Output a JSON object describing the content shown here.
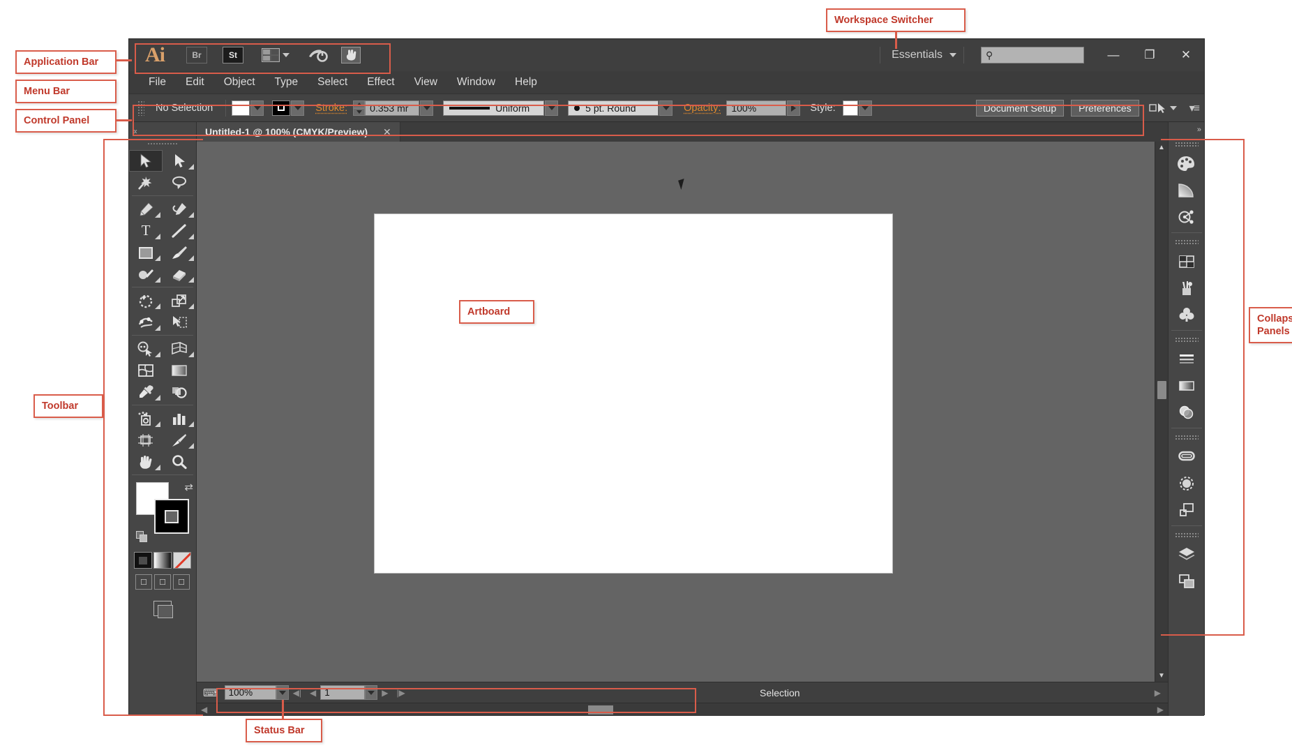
{
  "app": {
    "logo": "Ai",
    "buttons": [
      {
        "name": "bridge-button",
        "label": "Br"
      },
      {
        "name": "stock-button",
        "label": "St"
      }
    ],
    "arrange_documents": "arrange-documents-icon",
    "gear": "gear-icon",
    "hand": "hand-pointer-icon",
    "workspace": "Essentials",
    "search_placeholder": "",
    "search_value": "",
    "window_controls": {
      "minimize": "—",
      "maximize": "❐",
      "close": "✕"
    }
  },
  "menu": {
    "items": [
      "File",
      "Edit",
      "Object",
      "Type",
      "Select",
      "Effect",
      "View",
      "Window",
      "Help"
    ]
  },
  "control_panel": {
    "selection_state": "No Selection",
    "fill_label": "fill-swatch",
    "stroke_label": "stroke-swatch",
    "stroke_text": "Stroke:",
    "stroke_weight": "0.353 mr",
    "stroke_profile": "Uniform",
    "brush_definition": "5 pt. Round",
    "opacity_text": "Opacity:",
    "opacity_value": "100%",
    "style_text": "Style:",
    "document_setup": "Document Setup",
    "preferences": "Preferences"
  },
  "toolbar": {
    "collapse": "«",
    "tools": [
      {
        "name": "selection-tool",
        "glyph": "selection",
        "active": true,
        "corner": false
      },
      {
        "name": "direct-selection-tool",
        "glyph": "direct-selection",
        "active": false,
        "corner": true
      },
      {
        "name": "magic-wand-tool",
        "glyph": "magic-wand",
        "active": false,
        "corner": false
      },
      {
        "name": "lasso-tool",
        "glyph": "lasso",
        "active": false,
        "corner": false
      },
      {
        "name": "pen-tool",
        "glyph": "pen",
        "active": false,
        "corner": true
      },
      {
        "name": "curvature-tool",
        "glyph": "curvature",
        "active": false,
        "corner": true
      },
      {
        "name": "type-tool",
        "glyph": "type",
        "active": false,
        "corner": true
      },
      {
        "name": "line-segment-tool",
        "glyph": "line",
        "active": false,
        "corner": true
      },
      {
        "name": "rectangle-tool",
        "glyph": "rectangle",
        "active": false,
        "corner": true
      },
      {
        "name": "paintbrush-tool",
        "glyph": "paintbrush",
        "active": false,
        "corner": true
      },
      {
        "name": "shaper-tool",
        "glyph": "shaper",
        "active": false,
        "corner": true
      },
      {
        "name": "eraser-tool",
        "glyph": "eraser",
        "active": false,
        "corner": true
      },
      {
        "name": "rotate-tool",
        "glyph": "rotate",
        "active": false,
        "corner": true
      },
      {
        "name": "scale-tool",
        "glyph": "scale",
        "active": false,
        "corner": true
      },
      {
        "name": "width-tool",
        "glyph": "width",
        "active": false,
        "corner": true
      },
      {
        "name": "free-transform-tool",
        "glyph": "free-transform",
        "active": false,
        "corner": false
      },
      {
        "name": "shape-builder-tool",
        "glyph": "shape-builder",
        "active": false,
        "corner": true
      },
      {
        "name": "perspective-grid-tool",
        "glyph": "perspective-grid",
        "active": false,
        "corner": true
      },
      {
        "name": "mesh-tool",
        "glyph": "mesh",
        "active": false,
        "corner": false
      },
      {
        "name": "gradient-tool",
        "glyph": "gradient",
        "active": false,
        "corner": false
      },
      {
        "name": "eyedropper-tool",
        "glyph": "eyedropper",
        "active": false,
        "corner": true
      },
      {
        "name": "blend-tool",
        "glyph": "blend",
        "active": false,
        "corner": false
      },
      {
        "name": "symbol-sprayer-tool",
        "glyph": "symbol-sprayer",
        "active": false,
        "corner": true
      },
      {
        "name": "column-graph-tool",
        "glyph": "column-graph",
        "active": false,
        "corner": true
      },
      {
        "name": "artboard-tool",
        "glyph": "artboard",
        "active": false,
        "corner": false
      },
      {
        "name": "slice-tool",
        "glyph": "slice",
        "active": false,
        "corner": true
      },
      {
        "name": "hand-tool",
        "glyph": "hand",
        "active": false,
        "corner": true
      },
      {
        "name": "zoom-tool",
        "glyph": "zoom",
        "active": false,
        "corner": false
      }
    ],
    "fill_color": "#ffffff",
    "stroke_color": "#000000",
    "modes": [
      "color-mode",
      "gradient-mode",
      "none-mode"
    ],
    "screen_modes": [
      "normal-screen-mode",
      "full-screen-menubar-mode",
      "full-screen-mode"
    ]
  },
  "document": {
    "tab_title": "Untitled-1 @ 100% (CMYK/Preview)",
    "close": "✕"
  },
  "status_bar": {
    "zoom": "100%",
    "artboard_number": "1",
    "tool_name": "Selection"
  },
  "panels": {
    "collapse": "»",
    "groups": [
      [
        "color-panel-icon",
        "color-guide-panel-icon",
        "color-themes-panel-icon"
      ],
      [
        "swatches-panel-icon",
        "brushes-panel-icon",
        "symbols-panel-icon"
      ],
      [
        "stroke-panel-icon",
        "gradient-panel-icon",
        "transparency-panel-icon"
      ],
      [
        "libraries-panel-icon",
        "appearance-panel-icon",
        "align-panel-icon"
      ],
      [
        "layers-panel-icon",
        "artboards-panel-icon"
      ]
    ]
  },
  "annotations": {
    "application_bar": "Application Bar",
    "menu_bar": "Menu Bar",
    "control_panel": "Control Panel",
    "toolbar": "Toolbar",
    "status_bar": "Status Bar",
    "workspace_switcher": "Workspace Switcher",
    "artboard": "Artboard",
    "collapsed_panels": "Collapsed\nPanels"
  },
  "colors": {
    "annotation": "#d95c4a",
    "annotation_text": "#c0392b",
    "accent_orange": "#e08a2e",
    "app_chrome": "#3c3c3c",
    "canvas": "#646464"
  }
}
